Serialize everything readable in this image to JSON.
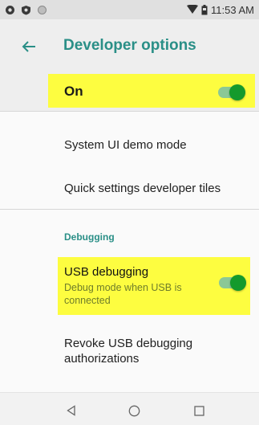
{
  "status_bar": {
    "time": "11:53 AM",
    "icons": [
      "circle-notification-icon",
      "shield-notification-icon",
      "circle-outline-icon",
      "wifi-icon",
      "battery-icon"
    ]
  },
  "toolbar": {
    "title": "Developer options",
    "back_icon": "arrow-left-icon"
  },
  "master_switch": {
    "label": "On",
    "state": "on"
  },
  "items": {
    "demo_mode": "System UI demo mode",
    "quick_tiles": "Quick settings developer tiles"
  },
  "debugging": {
    "header": "Debugging",
    "usb_title": "USB debugging",
    "usb_summary": "Debug mode when USB is connected",
    "usb_state": "on",
    "revoke": "Revoke USB debugging authorizations"
  },
  "nav": {
    "back_icon": "triangle-back-icon",
    "home_icon": "circle-home-icon",
    "recents_icon": "square-recents-icon"
  },
  "colors": {
    "accent": "#2a8f87",
    "highlight": "#fdfd40",
    "switch_thumb": "#149a2c",
    "switch_track": "#8bc896",
    "summary": "#6f7d2a"
  }
}
